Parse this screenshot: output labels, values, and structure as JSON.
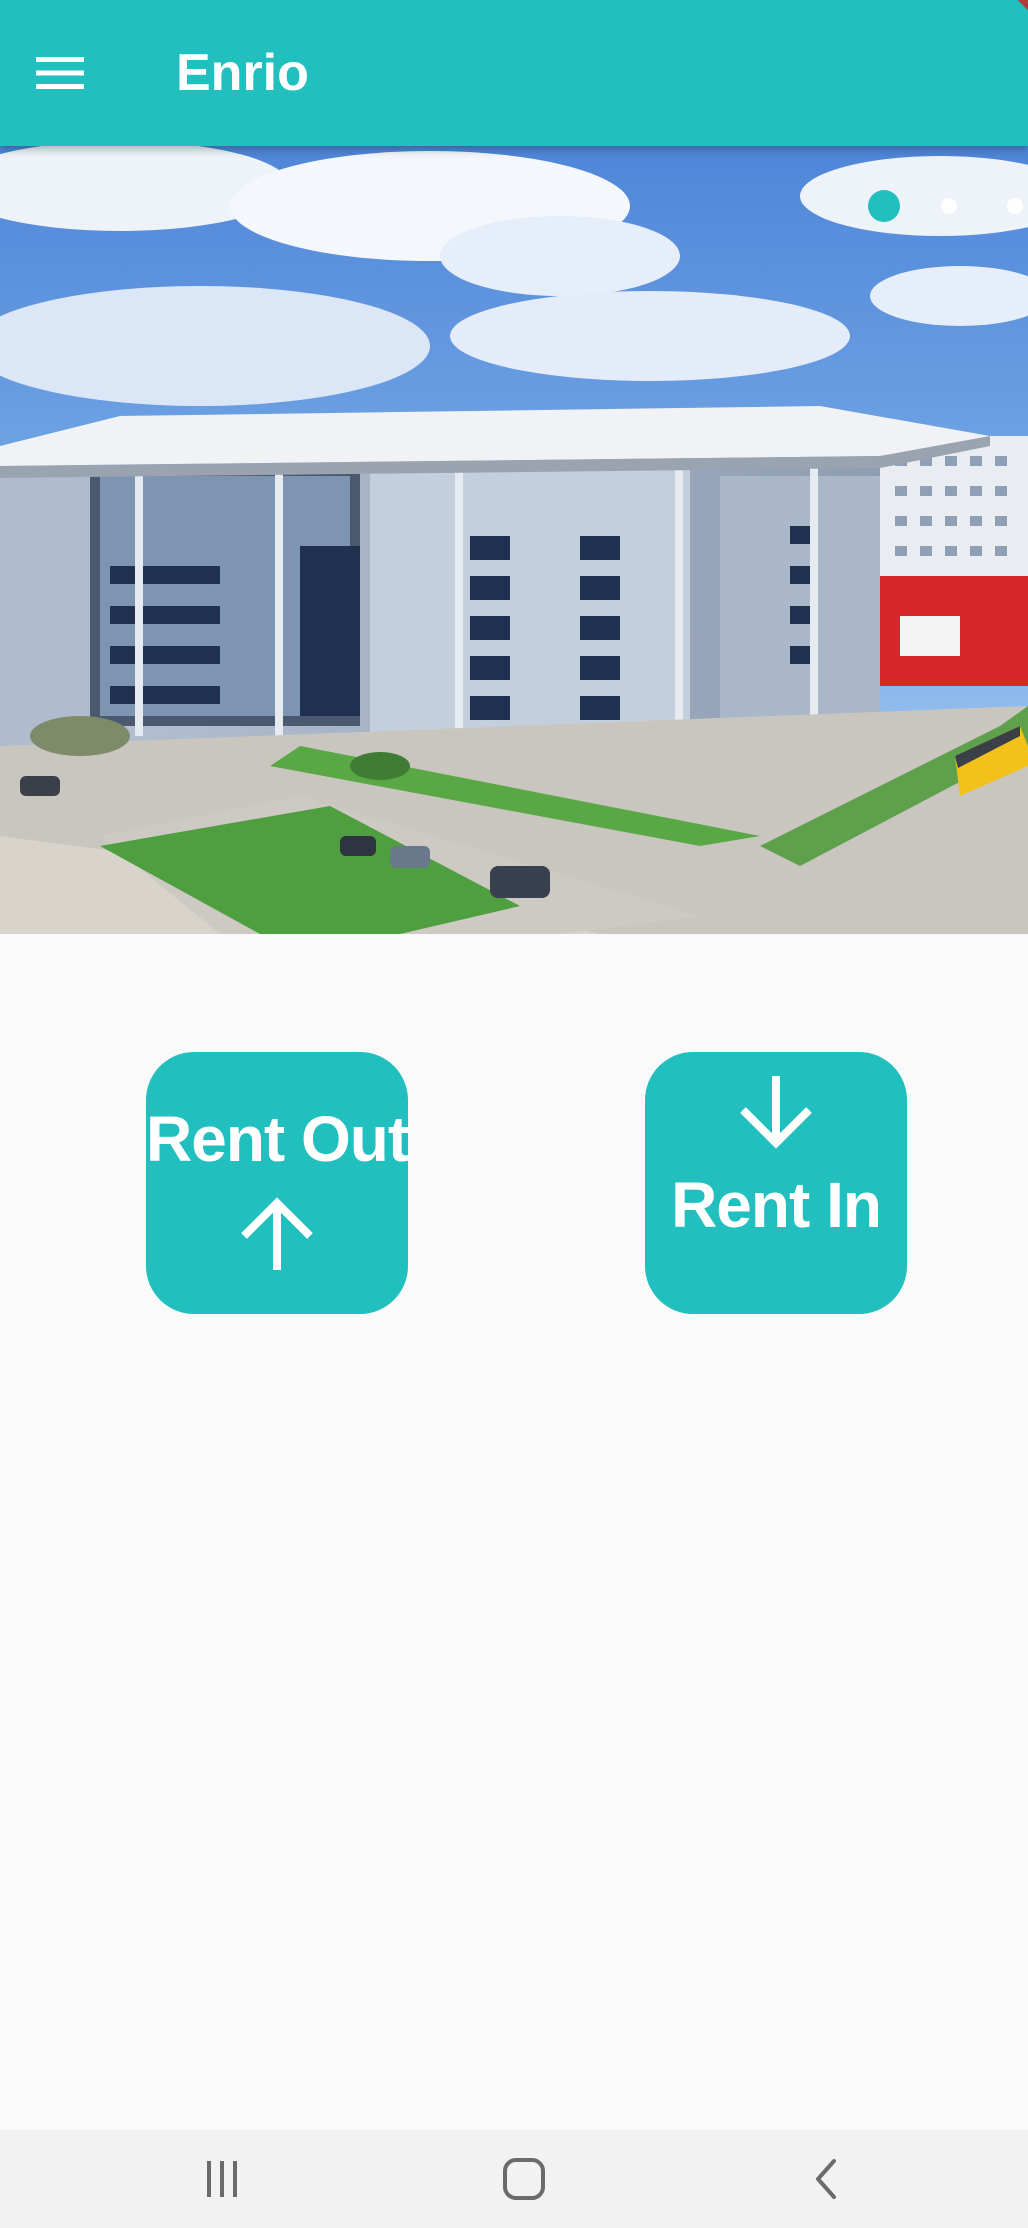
{
  "appbar": {
    "title": "Enrio",
    "menu_icon": "hamburger-menu-icon",
    "background": "#22bfbf"
  },
  "carousel": {
    "image_description": "Modern multi-story campus building under blue cloudy sky",
    "page_count": 3,
    "active_index": 0,
    "active_color": "#22bfbf",
    "inactive_color": "#ffffff"
  },
  "actions": {
    "rent_out": {
      "label": "Rent Out",
      "icon": "arrow-up-icon"
    },
    "rent_in": {
      "label": "Rent In",
      "icon": "arrow-down-icon"
    },
    "tile_color": "#22bfbf"
  },
  "system_nav": {
    "recents_icon": "recents-icon",
    "home_icon": "home-icon",
    "back_icon": "back-icon"
  }
}
